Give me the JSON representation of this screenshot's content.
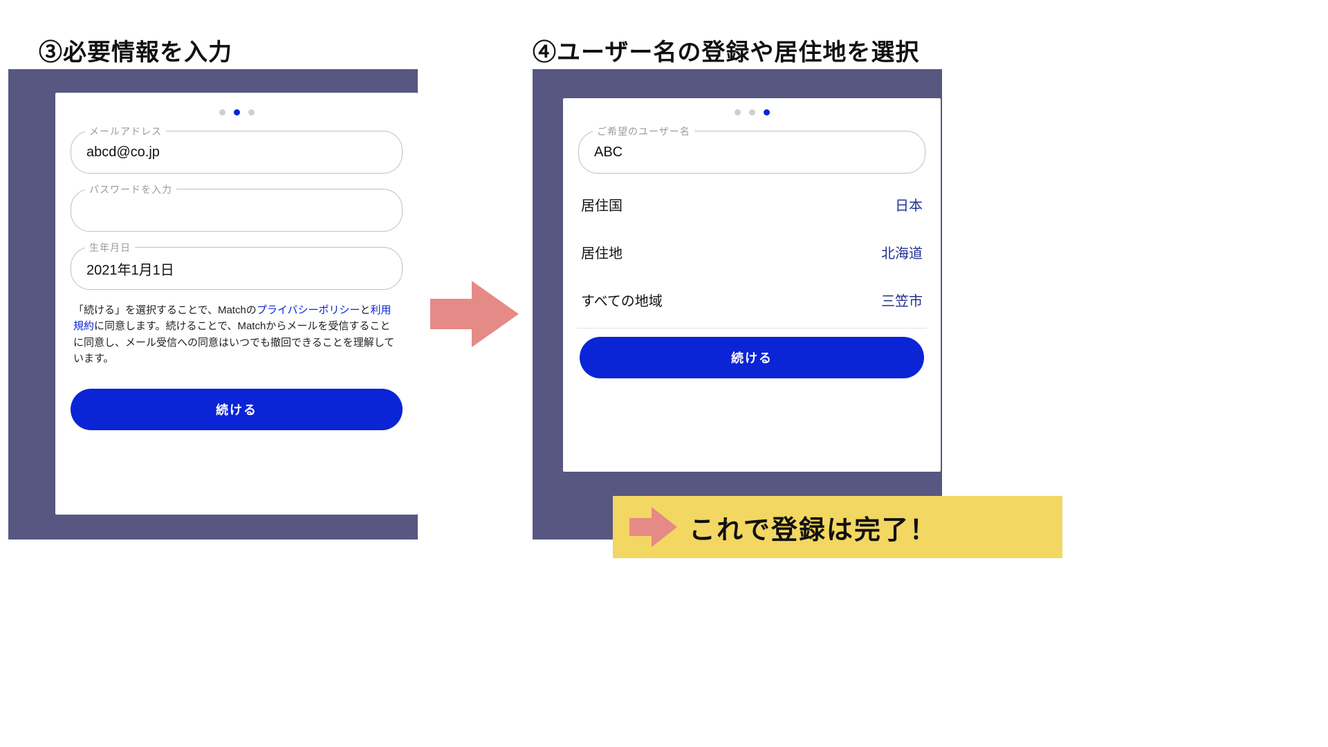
{
  "headings": {
    "step3": "③必要情報を入力",
    "step4": "④ユーザー名の登録や居住地を選択"
  },
  "left": {
    "dots": {
      "count": 3,
      "active_index": 1
    },
    "fields": {
      "email_label": "メールアドレス",
      "email_value": "abcd@co.jp",
      "password_label": "パスワードを入力",
      "password_value": "",
      "birth_label": "生年月日",
      "birth_value": "2021年1月1日"
    },
    "consent_parts": {
      "p1": "「続ける」を選択することで、Matchの",
      "link1": "プライバシーポリシー",
      "p2": "と",
      "link2": "利用規約",
      "p3": "に同意します。続けることで、Matchからメールを受信することに同意し、メール受信への同意はいつでも撤回できることを理解しています。"
    },
    "continue_label": "続ける"
  },
  "right": {
    "dots": {
      "count": 3,
      "active_index": 2
    },
    "username_label": "ご希望のユーザー名",
    "username_value": "ABC",
    "rows": [
      {
        "label": "居住国",
        "value": "日本"
      },
      {
        "label": "居住地",
        "value": "北海道"
      },
      {
        "label": "すべての地域",
        "value": "三笠市"
      }
    ],
    "continue_label": "続ける"
  },
  "banner": {
    "text": "これで登録は完了！"
  },
  "colors": {
    "accent": "#0b24d6",
    "frame": "#575782",
    "arrow": "#e58a87",
    "banner_bg": "#f2d762"
  }
}
